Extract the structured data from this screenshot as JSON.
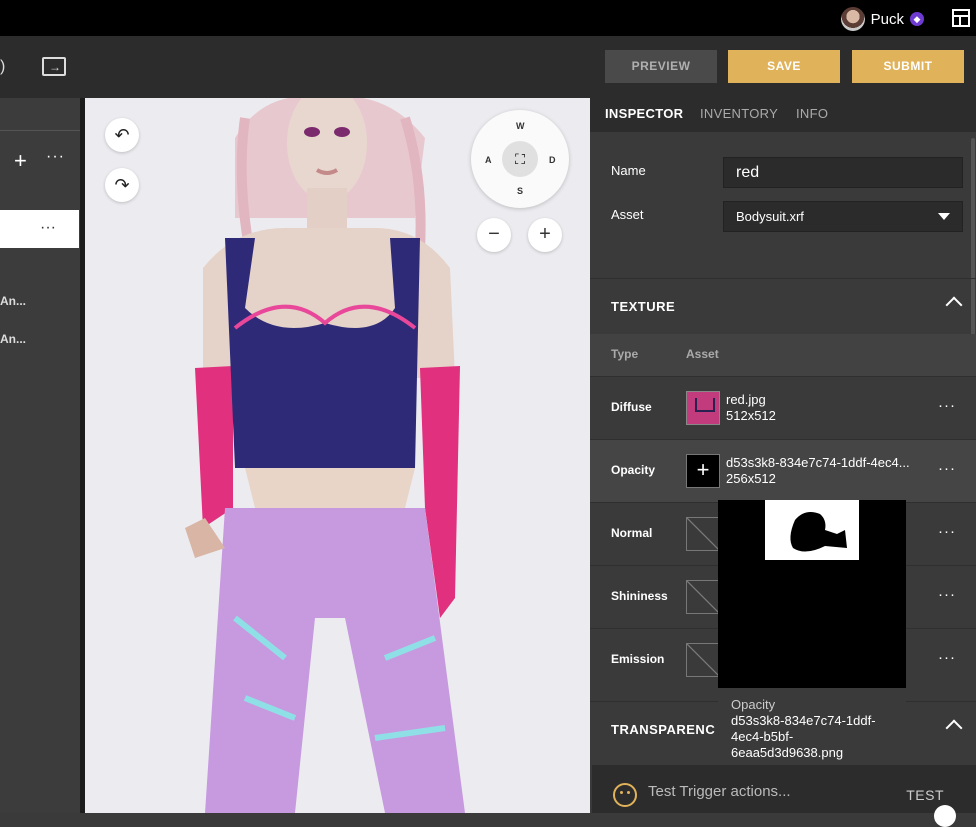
{
  "user": {
    "name": "Puck",
    "badge_icon": "gem-icon"
  },
  "toolbar": {
    "preview_label": "PREVIEW",
    "save_label": "SAVE",
    "submit_label": "SUBMIT",
    "accent": "#e0b25a"
  },
  "left_panel": {
    "items": [
      "An...",
      "An..."
    ]
  },
  "viewport": {
    "compass": {
      "n": "W",
      "w": "A",
      "e": "D",
      "s": "S"
    },
    "zoom_out": "−",
    "zoom_in": "+"
  },
  "inspector": {
    "tabs": [
      "INSPECTOR",
      "INVENTORY",
      "INFO"
    ],
    "name_label": "Name",
    "name_value": "red",
    "asset_label": "Asset",
    "asset_value": "Bodysuit.xrf",
    "texture_title": "TEXTURE",
    "col_type": "Type",
    "col_asset": "Asset",
    "rows": [
      {
        "type": "Diffuse",
        "file": "red.jpg",
        "size": "512x512"
      },
      {
        "type": "Opacity",
        "file": "d53s3k8-834e7c74-1ddf-4ec4...",
        "size": "256x512"
      },
      {
        "type": "Normal",
        "file": "",
        "size": ""
      },
      {
        "type": "Shininess",
        "file": "",
        "size": ""
      },
      {
        "type": "Emission",
        "file": "",
        "size": ""
      }
    ],
    "transparency_title": "TRANSPARENC"
  },
  "tooltip": {
    "label": "Opacity",
    "filename": "d53s3k8-834e7c74-1ddf-4ec4-b5bf-6eaa5d3d9638.png"
  },
  "chat": {
    "placeholder": "Test Trigger actions...",
    "test_label": "TEST"
  }
}
